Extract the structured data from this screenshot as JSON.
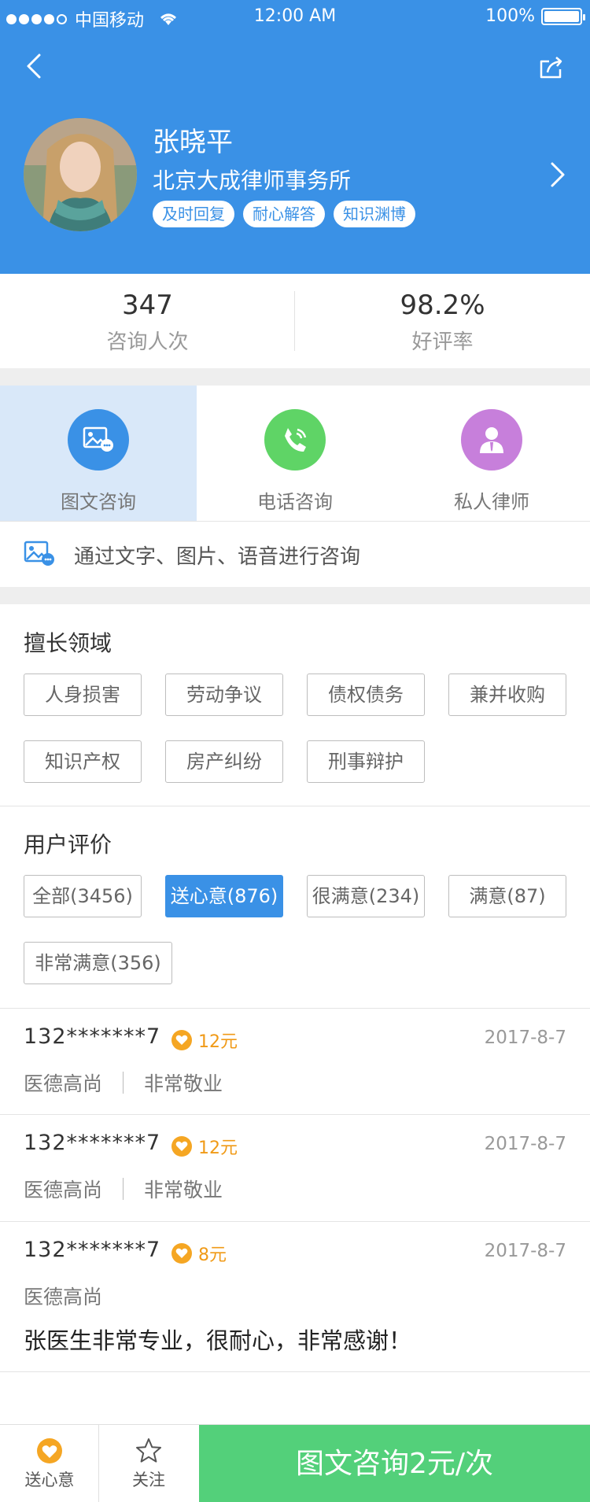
{
  "status_bar": {
    "carrier": "中国移动",
    "time": "12:00 AM",
    "battery": "100%"
  },
  "nav": {
    "back_icon": "chevron-left-icon",
    "share_icon": "share-icon"
  },
  "profile": {
    "name": "张晓平",
    "firm": "北京大成律师事务所",
    "tags": [
      "及时回复",
      "耐心解答",
      "知识渊博"
    ]
  },
  "stats": {
    "consultations": {
      "value": "347",
      "label": "咨询人次"
    },
    "rating": {
      "value": "98.2%",
      "label": "好评率"
    }
  },
  "services": {
    "items": [
      {
        "label": "图文咨询",
        "icon": "image-chat-icon",
        "color": "#3a91e6",
        "active": true
      },
      {
        "label": "电话咨询",
        "icon": "phone-icon",
        "color": "#5fd466",
        "active": false
      },
      {
        "label": "私人律师",
        "icon": "person-icon",
        "color": "#c77fdb",
        "active": false
      }
    ],
    "description": "通过文字、图片、语音进行咨询"
  },
  "expertise": {
    "title": "擅长领域",
    "items": [
      "人身损害",
      "劳动争议",
      "债权债务",
      "兼并收购",
      "知识产权",
      "房产纠纷",
      "刑事辩护"
    ]
  },
  "reviews_filter": {
    "title": "用户评价",
    "filters": [
      "全部(3456)",
      "送心意(876)",
      "很满意(234)",
      "满意(87)",
      "非常满意(356)"
    ],
    "selected": "送心意(876)"
  },
  "reviews": [
    {
      "user": "132*******7",
      "gift": "12元",
      "date": "2017-8-7",
      "tags": [
        "医德高尚",
        "非常敬业"
      ],
      "text": ""
    },
    {
      "user": "132*******7",
      "gift": "12元",
      "date": "2017-8-7",
      "tags": [
        "医德高尚",
        "非常敬业"
      ],
      "text": ""
    },
    {
      "user": "132*******7",
      "gift": "8元",
      "date": "2017-8-7",
      "tags": [
        "医德高尚"
      ],
      "text": "张医生非常专业，很耐心，非常感谢！"
    }
  ],
  "bottom_bar": {
    "gift_label": "送心意",
    "follow_label": "关注",
    "cta_label": "图文咨询2元/次"
  },
  "colors": {
    "primary": "#3a91e6",
    "cta": "#53d07a",
    "gift": "#f5a623"
  }
}
